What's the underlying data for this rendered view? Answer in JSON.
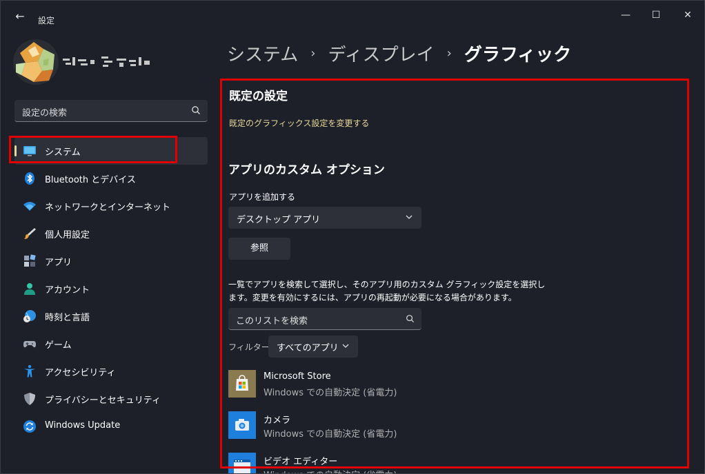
{
  "window": {
    "title": "設定",
    "back": "←",
    "minimize": "—",
    "maximize": "☐",
    "close": "✕"
  },
  "sidebar": {
    "search_placeholder": "設定の検索",
    "items": [
      {
        "label": "システム",
        "icon": "monitor-icon"
      },
      {
        "label": "Bluetooth とデバイス",
        "icon": "bluetooth-icon"
      },
      {
        "label": "ネットワークとインターネット",
        "icon": "wifi-icon"
      },
      {
        "label": "個人用設定",
        "icon": "brush-icon"
      },
      {
        "label": "アプリ",
        "icon": "apps-icon"
      },
      {
        "label": "アカウント",
        "icon": "person-icon"
      },
      {
        "label": "時刻と言語",
        "icon": "globe-clock-icon"
      },
      {
        "label": "ゲーム",
        "icon": "gamepad-icon"
      },
      {
        "label": "アクセシビリティ",
        "icon": "accessibility-icon"
      },
      {
        "label": "プライバシーとセキュリティ",
        "icon": "shield-icon"
      },
      {
        "label": "Windows Update",
        "icon": "update-icon"
      }
    ]
  },
  "breadcrumb": {
    "item1": "システム",
    "sep": "›",
    "item2": "ディスプレイ",
    "current": "グラフィック"
  },
  "content": {
    "default_heading": "既定の設定",
    "default_link": "既定のグラフィックス設定を変更する",
    "custom_heading": "アプリのカスタム オプション",
    "add_app_label": "アプリを追加する",
    "app_type_value": "デスクトップ アプリ",
    "browse_label": "参照",
    "description": "一覧でアプリを検索して選択し、そのアプリ用のカスタム グラフィック設定を選択します。変更を有効にするには、アプリの再起動が必要になる場合があります。",
    "list_search_placeholder": "このリストを検索",
    "filter_label": "フィルター:",
    "filter_value": "すべてのアプリ",
    "apps": [
      {
        "name": "Microsoft Store",
        "status": "Windows での自動決定 (省電力)"
      },
      {
        "name": "カメラ",
        "status": "Windows での自動決定 (省電力)"
      },
      {
        "name": "ビデオ エディター",
        "status": "Windows での自動決定 (省電力)"
      }
    ]
  },
  "colors": {
    "accent": "#e8d49a",
    "highlight_red": "#e00000",
    "background": "#1d2028"
  }
}
